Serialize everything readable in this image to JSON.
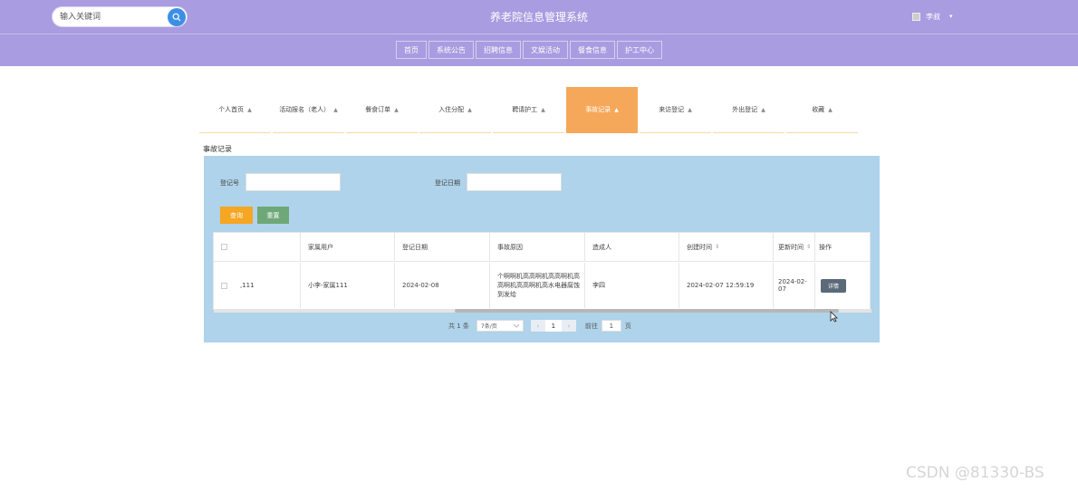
{
  "header": {
    "search_placeholder": "输入关键词",
    "site_title": "养老院信息管理系统",
    "user_name": "李叔",
    "user_caret": "▾"
  },
  "nav": {
    "items": [
      "首页",
      "系统公告",
      "招聘信息",
      "文娱活动",
      "餐食信息",
      "护工中心"
    ]
  },
  "tabs": [
    {
      "label": "个人首页"
    },
    {
      "label": "活动报名（老人）"
    },
    {
      "label": "餐食订单"
    },
    {
      "label": "入住分配"
    },
    {
      "label": "聘请护工"
    },
    {
      "label": "事故记录"
    },
    {
      "label": "来访登记"
    },
    {
      "label": "外出登记"
    },
    {
      "label": "收藏"
    }
  ],
  "tab_icon": "▲",
  "section_title": "事故记录",
  "filters": {
    "field1_label": "登记号",
    "field2_label": "登记日期",
    "search_button": "查询",
    "reset_button": "重置"
  },
  "table": {
    "headers": {
      "col1": "",
      "col2": "家属用户",
      "col3": "登记日期",
      "col4": "事故原因",
      "col5": "造成人",
      "col6": "创建时间",
      "col7": "更新时间",
      "col8": "操作"
    },
    "sort_icon": "⇕",
    "rows": [
      {
        "col1": ",111",
        "col2": "小李-家属111",
        "col3": "2024-02-08",
        "col4": "个啊啊机高高啊机高高啊机高高啊机高高啊机高水电器腐蚀到发给",
        "col5": "李四",
        "col6": "2024-02-07 12:59:19",
        "col7": "2024-02-07",
        "action": "详情"
      }
    ]
  },
  "pager": {
    "total": "共 1 条",
    "page_size": "7条/页",
    "prev": "‹",
    "current": "1",
    "next": "›",
    "goto_label": "前往",
    "goto_value": "1",
    "page_unit": "页"
  },
  "watermark": "CSDN @81330-BS",
  "colors": {
    "header_bg": "#a99ce0",
    "active_tab": "#f6a85a",
    "panel_bg": "#aed3ea",
    "search_btn": "#f5a623",
    "reset_btn": "#6fa878",
    "detail_btn": "#5b6a78"
  }
}
